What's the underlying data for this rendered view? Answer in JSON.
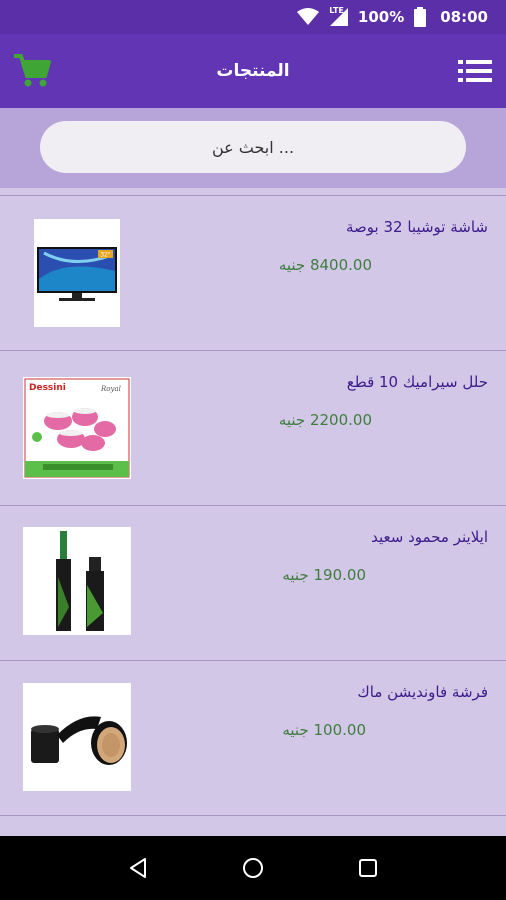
{
  "status_bar": {
    "network": "LTE",
    "battery": "100%",
    "time": "08:00"
  },
  "app_bar": {
    "title": "المنتجات",
    "menu_icon": "menu-list-icon",
    "cart_icon": "shopping-cart-icon"
  },
  "search": {
    "placeholder": "ابحث عن ..."
  },
  "products": [
    {
      "name": "شاشة توشيبا 32 بوصة",
      "price": "8400.00 جنيه",
      "image": "tv-image"
    },
    {
      "name": "حلل سيراميك 10 قطع",
      "price": "2200.00 جنيه",
      "image": "cookware-set-image"
    },
    {
      "name": "ايلاينر محمود سعيد",
      "price": "190.00 جنيه",
      "image": "eyeliner-image"
    },
    {
      "name": "فرشة فاونديشن ماك",
      "price": "100.00 جنيه",
      "image": "foundation-brush-image"
    }
  ],
  "thumb_text": {
    "tv_badge": "32\"",
    "cookware_brand": "Dessini",
    "cookware_script": "Royal"
  },
  "colors": {
    "primary": "#6235b4",
    "status_bar": "#5b2fa8",
    "cart_icon": "#3fa535",
    "name_text": "#3c1c8a",
    "price_text": "#3e7d3e",
    "list_bg": "#d3c7e8"
  }
}
